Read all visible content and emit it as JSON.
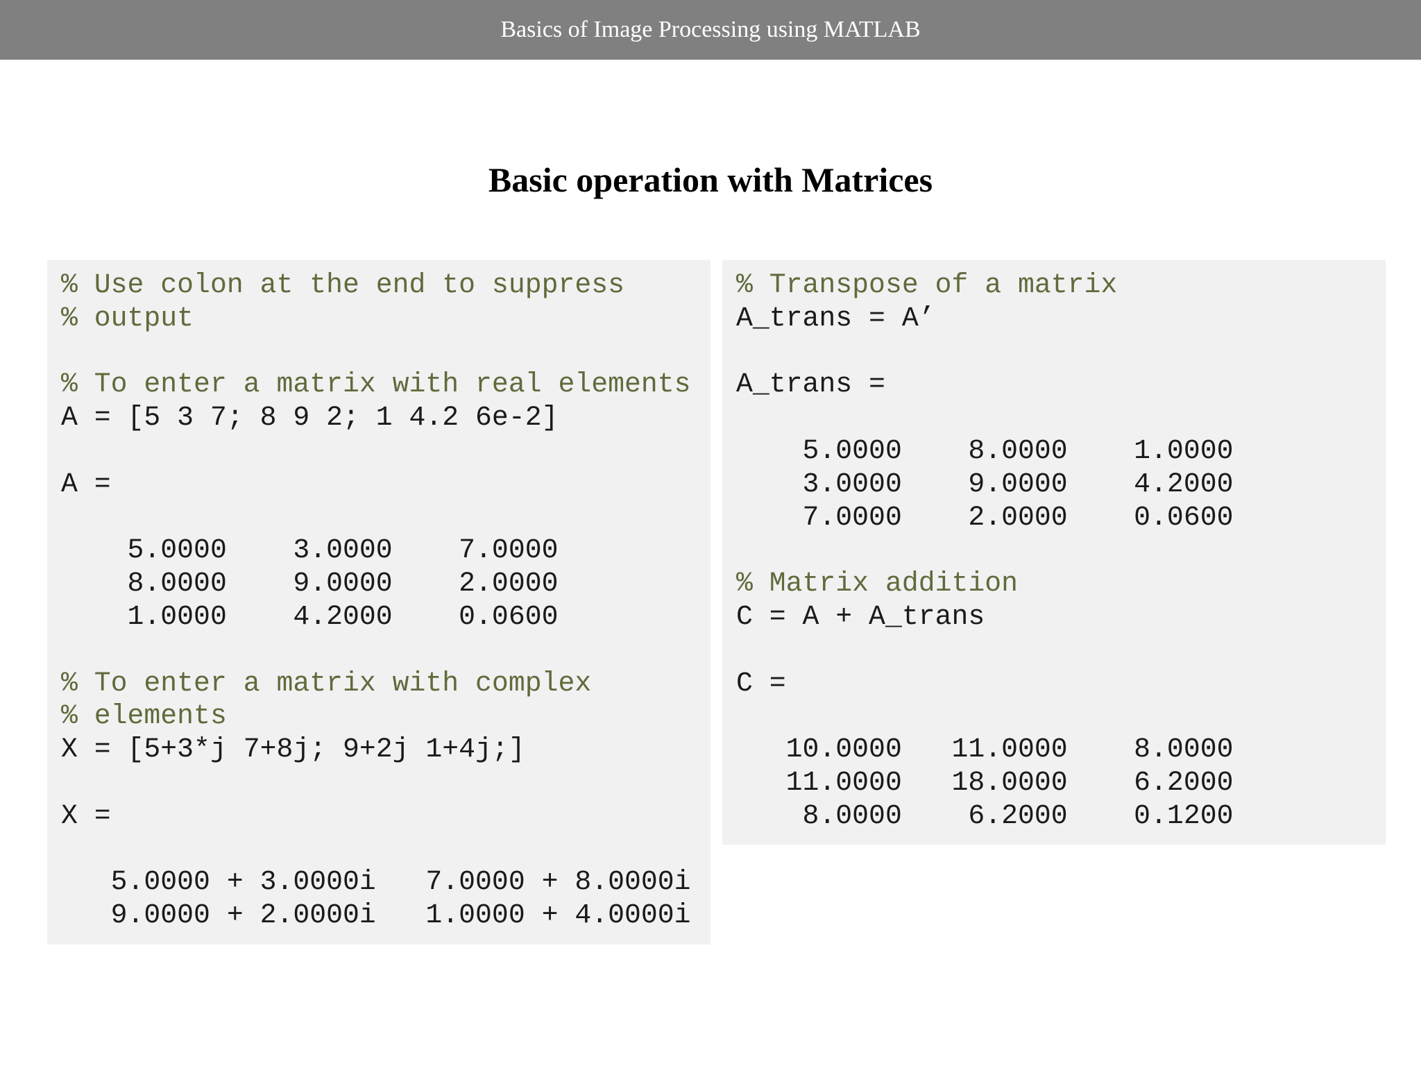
{
  "header": {
    "text": "Basics of Image Processing using MATLAB"
  },
  "slide": {
    "title": "Basic operation with Matrices"
  },
  "left_panel": {
    "lines": [
      {
        "text": "% Use colon at the end to suppress",
        "kind": "comment"
      },
      {
        "text": "% output",
        "kind": "comment"
      },
      {
        "text": "",
        "kind": "code"
      },
      {
        "text": "% To enter a matrix with real elements",
        "kind": "comment"
      },
      {
        "text": "A = [5 3 7; 8 9 2; 1 4.2 6e-2]",
        "kind": "code"
      },
      {
        "text": "",
        "kind": "code"
      },
      {
        "text": "A =",
        "kind": "code"
      },
      {
        "text": "",
        "kind": "code"
      },
      {
        "text": "    5.0000    3.0000    7.0000",
        "kind": "code"
      },
      {
        "text": "    8.0000    9.0000    2.0000",
        "kind": "code"
      },
      {
        "text": "    1.0000    4.2000    0.0600",
        "kind": "code"
      },
      {
        "text": "",
        "kind": "code"
      },
      {
        "text": "% To enter a matrix with complex",
        "kind": "comment"
      },
      {
        "text": "% elements",
        "kind": "comment"
      },
      {
        "text": "X = [5+3*j 7+8j; 9+2j 1+4j;]",
        "kind": "code"
      },
      {
        "text": "",
        "kind": "code"
      },
      {
        "text": "X =",
        "kind": "code"
      },
      {
        "text": "",
        "kind": "code"
      },
      {
        "text": "   5.0000 + 3.0000i   7.0000 + 8.0000i",
        "kind": "code"
      },
      {
        "text": "   9.0000 + 2.0000i   1.0000 + 4.0000i",
        "kind": "code"
      }
    ]
  },
  "right_panel": {
    "lines": [
      {
        "text": "% Transpose of a matrix",
        "kind": "comment"
      },
      {
        "text": "A_trans = A’",
        "kind": "code"
      },
      {
        "text": "",
        "kind": "code"
      },
      {
        "text": "A_trans =",
        "kind": "code"
      },
      {
        "text": "",
        "kind": "code"
      },
      {
        "text": "    5.0000    8.0000    1.0000",
        "kind": "code"
      },
      {
        "text": "    3.0000    9.0000    4.2000",
        "kind": "code"
      },
      {
        "text": "    7.0000    2.0000    0.0600",
        "kind": "code"
      },
      {
        "text": "",
        "kind": "code"
      },
      {
        "text": "% Matrix addition",
        "kind": "comment"
      },
      {
        "text": "C = A + A_trans",
        "kind": "code"
      },
      {
        "text": "",
        "kind": "code"
      },
      {
        "text": "C =",
        "kind": "code"
      },
      {
        "text": "",
        "kind": "code"
      },
      {
        "text": "   10.0000   11.0000    8.0000",
        "kind": "code"
      },
      {
        "text": "   11.0000   18.0000    6.2000",
        "kind": "code"
      },
      {
        "text": "    8.0000    6.2000    0.1200",
        "kind": "code"
      }
    ]
  },
  "colors": {
    "header_bg": "#808080",
    "panel_bg": "#f1f1f2",
    "comment": "#5f6b3b",
    "code": "#1a1a1a"
  }
}
